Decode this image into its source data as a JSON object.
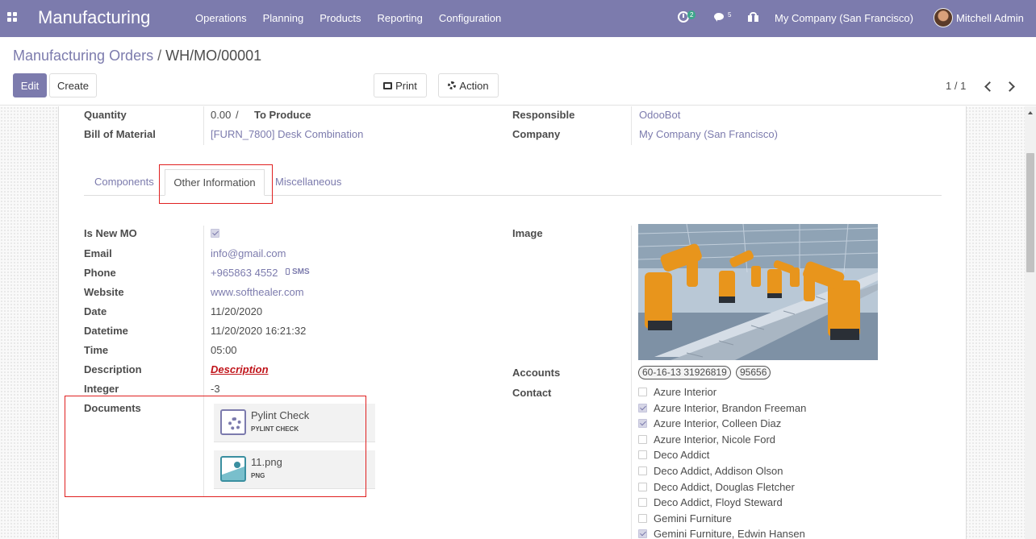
{
  "navbar": {
    "app_name": "Manufacturing",
    "menu": [
      "Operations",
      "Planning",
      "Products",
      "Reporting",
      "Configuration"
    ],
    "activity_count": "2",
    "message_count": "5",
    "company": "My Company (San Francisco)",
    "user": "Mitchell Admin"
  },
  "breadcrumb": {
    "parent": "Manufacturing Orders",
    "separator": "/",
    "current": "WH/MO/00001"
  },
  "buttons": {
    "edit": "Edit",
    "create": "Create",
    "print": "Print",
    "action": "Action"
  },
  "pager": {
    "value": "1 / 1"
  },
  "header_fields": {
    "quantity_label": "Quantity",
    "quantity_value": "0.00",
    "quantity_sep": "/",
    "to_produce": "To Produce",
    "bom_label": "Bill of Material",
    "bom_value": "[FURN_7800] Desk Combination",
    "responsible_label": "Responsible",
    "responsible_value": "OdooBot",
    "company_label": "Company",
    "company_value": "My Company (San Francisco)"
  },
  "tabs": [
    "Components",
    "Other Information",
    "Miscellaneous"
  ],
  "active_tab": "Other Information",
  "fields": {
    "is_new_mo_label": "Is New MO",
    "is_new_mo": true,
    "email_label": "Email",
    "email": "info@gmail.com",
    "phone_label": "Phone",
    "phone": "+965863 4552",
    "sms": "SMS",
    "website_label": "Website",
    "website": "www.softhealer.com",
    "date_label": "Date",
    "date": "11/20/2020",
    "datetime_label": "Datetime",
    "datetime": "11/20/2020 16:21:32",
    "time_label": "Time",
    "time": "05:00",
    "description_label": "Description",
    "description": "Description",
    "integer_label": "Integer",
    "integer": "-3",
    "documents_label": "Documents",
    "image_label": "Image",
    "accounts_label": "Accounts",
    "contact_label": "Contact"
  },
  "documents": [
    {
      "name": "Pylint Check",
      "type": "PYLINT CHECK",
      "icon": "gear-icon"
    },
    {
      "name": "11.png",
      "type": "PNG",
      "icon": "image-icon"
    }
  ],
  "accounts": [
    "60-16-13 31926819",
    "95656"
  ],
  "contacts": [
    {
      "name": "Azure Interior",
      "checked": false
    },
    {
      "name": "Azure Interior, Brandon Freeman",
      "checked": true
    },
    {
      "name": "Azure Interior, Colleen Diaz",
      "checked": true
    },
    {
      "name": "Azure Interior, Nicole Ford",
      "checked": false
    },
    {
      "name": "Deco Addict",
      "checked": false
    },
    {
      "name": "Deco Addict, Addison Olson",
      "checked": false
    },
    {
      "name": "Deco Addict, Douglas Fletcher",
      "checked": false
    },
    {
      "name": "Deco Addict, Floyd Steward",
      "checked": false
    },
    {
      "name": "Gemini Furniture",
      "checked": false
    },
    {
      "name": "Gemini Furniture, Edwin Hansen",
      "checked": true
    }
  ],
  "colors": {
    "brand": "#7c7bad",
    "highlight_box": "#e02020",
    "description": "#c0141a"
  }
}
